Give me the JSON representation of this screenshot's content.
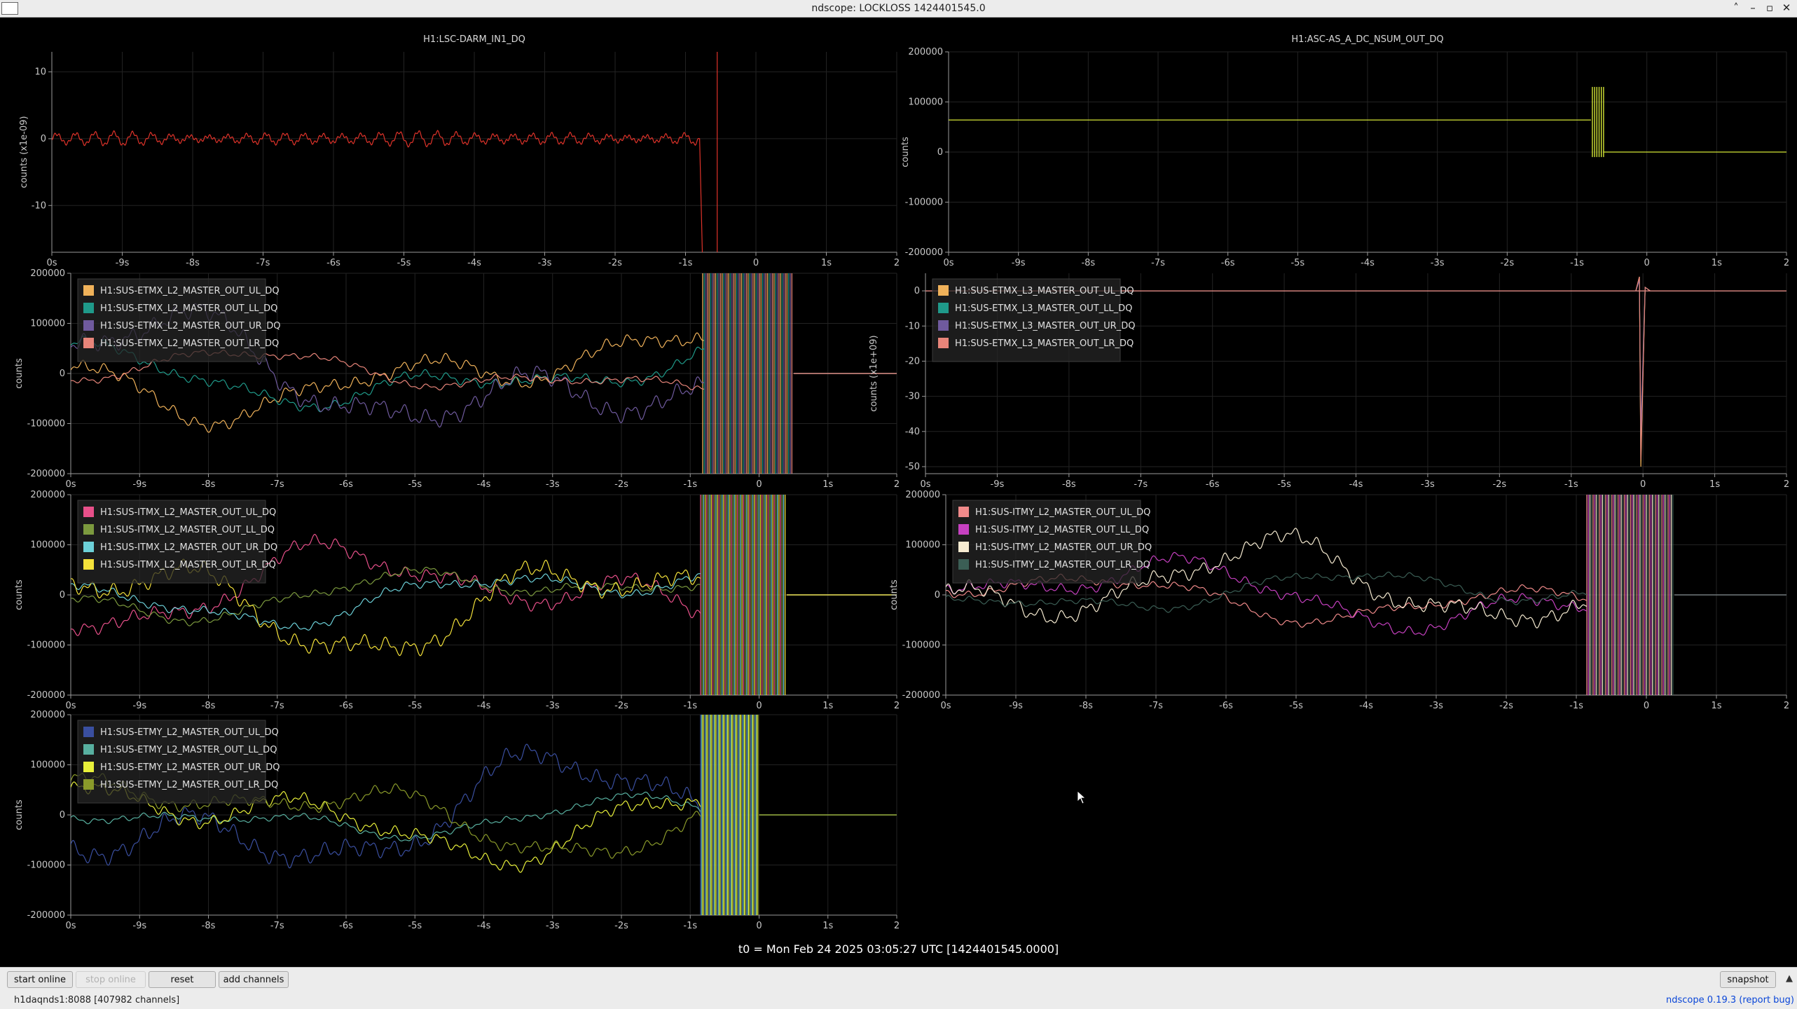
{
  "window": {
    "title": "ndscope: LOCKLOSS 1424401545.0"
  },
  "x_tick_labels": [
    "0s",
    "-9s",
    "-8s",
    "-7s",
    "-6s",
    "-5s",
    "-4s",
    "-3s",
    "-2s",
    "-1s",
    "0",
    "1s",
    "2"
  ],
  "t0_label": "t0 = Mon Feb 24 2025 03:05:27 UTC [1424401545.0000]",
  "buttons": {
    "start_online": "start online",
    "stop_online": "stop online",
    "reset": "reset",
    "add_channels": "add channels",
    "snapshot": "snapshot"
  },
  "status": {
    "server": "h1daqnds1:8088  [407982 channels]",
    "version_link": "ndscope 0.19.3",
    "report_bug": "(report bug)"
  },
  "colors": {
    "background": "#000000",
    "axis": "#9a9a9a",
    "grid": "#262626"
  },
  "chart_data": [
    {
      "type": "line",
      "title": "H1:LSC-DARM_IN1_DQ",
      "ylabel": "counts (x1e-09)",
      "xlim": [
        -10,
        2
      ],
      "ylim": [
        -17,
        13
      ],
      "yticks": [
        10,
        0,
        -10
      ],
      "ytick_labels": [
        "10",
        "0",
        "-10"
      ],
      "legend": [],
      "series": [
        {
          "name": "",
          "color": "#e0332a",
          "kind": "osc",
          "amp": 0.7,
          "offset": 0,
          "freq": 3.7,
          "end": -0.8,
          "spike": -0.55
        }
      ]
    },
    {
      "type": "line",
      "title": "H1:ASC-AS_A_DC_NSUM_OUT_DQ",
      "ylabel": "counts",
      "xlim": [
        -10,
        2
      ],
      "ylim": [
        -200000,
        200000
      ],
      "yticks": [
        200000,
        100000,
        0,
        -100000,
        -200000
      ],
      "ytick_labels": [
        "200000",
        "100000",
        "0",
        "-100000",
        "-200000"
      ],
      "legend": [],
      "series": [
        {
          "name": "",
          "color": "#d4e636",
          "kind": "step",
          "hi": 64000,
          "lo": 0,
          "t_end": -0.8,
          "burst": [
            -0.78,
            -0.62
          ]
        }
      ]
    },
    {
      "type": "line",
      "ylabel": "counts",
      "xlim": [
        -10,
        2
      ],
      "ylim": [
        -200000,
        200000
      ],
      "yticks": [
        200000,
        100000,
        0,
        -100000,
        -200000
      ],
      "ytick_labels": [
        "200000",
        "100000",
        "0",
        "-100000",
        "-200000"
      ],
      "legend": [
        "H1:SUS-ETMX_L2_MASTER_OUT_UL_DQ",
        "H1:SUS-ETMX_L2_MASTER_OUT_LL_DQ",
        "H1:SUS-ETMX_L2_MASTER_OUT_UR_DQ",
        "H1:SUS-ETMX_L2_MASTER_OUT_LR_DQ"
      ],
      "series": [
        {
          "name": "H1:SUS-ETMX_L2_MASTER_OUT_UL_DQ",
          "color": "#f0b25a",
          "kind": "wander",
          "seed": 1,
          "amp": 120000,
          "end": -0.8,
          "flat": 0.5,
          "burst": [
            -0.82,
            0.5
          ]
        },
        {
          "name": "H1:SUS-ETMX_L2_MASTER_OUT_LL_DQ",
          "color": "#1f9a8a",
          "kind": "wander",
          "seed": 2,
          "amp": 90000,
          "end": -0.8,
          "flat": 0.5,
          "burst": [
            -0.82,
            0.5
          ]
        },
        {
          "name": "H1:SUS-ETMX_L2_MASTER_OUT_UR_DQ",
          "color": "#6f5a9e",
          "kind": "wander",
          "seed": 3,
          "amp": 170000,
          "end": -0.8,
          "flat": 0.5,
          "burst": [
            -0.82,
            0.5
          ]
        },
        {
          "name": "H1:SUS-ETMX_L2_MASTER_OUT_LR_DQ",
          "color": "#e8857a",
          "kind": "wander",
          "seed": 4,
          "amp": 60000,
          "end": -0.8,
          "flat": 0.5,
          "burst": [
            -0.82,
            0.5
          ]
        }
      ]
    },
    {
      "type": "line",
      "ylabel": "counts (x1e+09)",
      "xlim": [
        -10,
        2
      ],
      "ylim": [
        -52,
        5
      ],
      "yticks": [
        0,
        -10,
        -20,
        -30,
        -40,
        -50
      ],
      "ytick_labels": [
        "0",
        "-10",
        "-20",
        "-30",
        "-40",
        "-50"
      ],
      "legend": [
        "H1:SUS-ETMX_L3_MASTER_OUT_UL_DQ",
        "H1:SUS-ETMX_L3_MASTER_OUT_LL_DQ",
        "H1:SUS-ETMX_L3_MASTER_OUT_UR_DQ",
        "H1:SUS-ETMX_L3_MASTER_OUT_LR_DQ"
      ],
      "series": [
        {
          "name": "H1:SUS-ETMX_L3_MASTER_OUT_UL_DQ",
          "color": "#f0b25a",
          "kind": "flatspike",
          "spike": -0.05,
          "low": -50,
          "high": 4
        },
        {
          "name": "H1:SUS-ETMX_L3_MASTER_OUT_LL_DQ",
          "color": "#1f9a8a",
          "kind": "flatspike",
          "spike": -0.05,
          "low": -45,
          "high": 3
        },
        {
          "name": "H1:SUS-ETMX_L3_MASTER_OUT_UR_DQ",
          "color": "#6f5a9e",
          "kind": "flatspike",
          "spike": -0.05,
          "low": -40,
          "high": 3
        },
        {
          "name": "H1:SUS-ETMX_L3_MASTER_OUT_LR_DQ",
          "color": "#e8857a",
          "kind": "flatspike",
          "spike": -0.05,
          "low": -48,
          "high": 4
        }
      ]
    },
    {
      "type": "line",
      "ylabel": "counts",
      "xlim": [
        -10,
        2
      ],
      "ylim": [
        -200000,
        200000
      ],
      "yticks": [
        200000,
        100000,
        0,
        -100000,
        -200000
      ],
      "ytick_labels": [
        "200000",
        "100000",
        "0",
        "-100000",
        "-200000"
      ],
      "legend": [
        "H1:SUS-ITMX_L2_MASTER_OUT_UL_DQ",
        "H1:SUS-ITMX_L2_MASTER_OUT_LL_DQ",
        "H1:SUS-ITMX_L2_MASTER_OUT_UR_DQ",
        "H1:SUS-ITMX_L2_MASTER_OUT_LR_DQ"
      ],
      "series": [
        {
          "name": "H1:SUS-ITMX_L2_MASTER_OUT_UL_DQ",
          "color": "#e8508a",
          "kind": "wander",
          "seed": 5,
          "amp": 130000,
          "end": -0.85,
          "flat": 0.4,
          "burst": [
            -0.85,
            0.4
          ]
        },
        {
          "name": "H1:SUS-ITMX_L2_MASTER_OUT_LL_DQ",
          "color": "#7c9a3e",
          "kind": "wander",
          "seed": 6,
          "amp": 70000,
          "end": -0.85,
          "flat": 0.4,
          "burst": [
            -0.85,
            0.4
          ]
        },
        {
          "name": "H1:SUS-ITMX_L2_MASTER_OUT_UR_DQ",
          "color": "#6cd0d8",
          "kind": "wander",
          "seed": 7,
          "amp": 80000,
          "end": -0.85,
          "flat": 0.4,
          "burst": [
            -0.85,
            0.4
          ]
        },
        {
          "name": "H1:SUS-ITMX_L2_MASTER_OUT_LR_DQ",
          "color": "#f4e23a",
          "kind": "wander",
          "seed": 8,
          "amp": 160000,
          "end": -0.85,
          "flat": 0.4,
          "burst": [
            -0.85,
            0.4
          ]
        }
      ]
    },
    {
      "type": "line",
      "ylabel": "counts",
      "xlim": [
        -10,
        2
      ],
      "ylim": [
        -200000,
        200000
      ],
      "yticks": [
        200000,
        100000,
        0,
        -100000,
        -200000
      ],
      "ytick_labels": [
        "200000",
        "100000",
        "0",
        "-100000",
        "-200000"
      ],
      "legend": [
        "H1:SUS-ITMY_L2_MASTER_OUT_UL_DQ",
        "H1:SUS-ITMY_L2_MASTER_OUT_LL_DQ",
        "H1:SUS-ITMY_L2_MASTER_OUT_UR_DQ",
        "H1:SUS-ITMY_L2_MASTER_OUT_LR_DQ"
      ],
      "series": [
        {
          "name": "H1:SUS-ITMY_L2_MASTER_OUT_UL_DQ",
          "color": "#f08a8a",
          "kind": "wander",
          "seed": 9,
          "amp": 70000,
          "end": -0.85,
          "flat": 0.4,
          "burst": [
            -0.85,
            0.4
          ]
        },
        {
          "name": "H1:SUS-ITMY_L2_MASTER_OUT_LL_DQ",
          "color": "#c640c0",
          "kind": "wander",
          "seed": 10,
          "amp": 100000,
          "end": -0.85,
          "flat": 0.4,
          "burst": [
            -0.85,
            0.4
          ]
        },
        {
          "name": "H1:SUS-ITMY_L2_MASTER_OUT_UR_DQ",
          "color": "#f7ecd2",
          "kind": "wander",
          "seed": 11,
          "amp": 140000,
          "end": -0.85,
          "flat": 0.4,
          "burst": [
            -0.85,
            0.4
          ]
        },
        {
          "name": "H1:SUS-ITMY_L2_MASTER_OUT_LR_DQ",
          "color": "#3b5e55",
          "kind": "wander",
          "seed": 12,
          "amp": 60000,
          "end": -0.85,
          "flat": 0.4,
          "burst": [
            -0.85,
            0.4
          ]
        }
      ]
    },
    {
      "type": "line",
      "ylabel": "counts",
      "xlim": [
        -10,
        2
      ],
      "ylim": [
        -200000,
        200000
      ],
      "yticks": [
        200000,
        100000,
        0,
        -100000,
        -200000
      ],
      "ytick_labels": [
        "200000",
        "100000",
        "0",
        "-100000",
        "-200000"
      ],
      "legend": [
        "H1:SUS-ETMY_L2_MASTER_OUT_UL_DQ",
        "H1:SUS-ETMY_L2_MASTER_OUT_LL_DQ",
        "H1:SUS-ETMY_L2_MASTER_OUT_UR_DQ",
        "H1:SUS-ETMY_L2_MASTER_OUT_LR_DQ"
      ],
      "series": [
        {
          "name": "H1:SUS-ETMY_L2_MASTER_OUT_UL_DQ",
          "color": "#3a4fa0",
          "kind": "wander",
          "seed": 13,
          "amp": 170000,
          "end": -0.85,
          "flat": 0,
          "burst": [
            -0.85,
            0
          ]
        },
        {
          "name": "H1:SUS-ETMY_L2_MASTER_OUT_LL_DQ",
          "color": "#58b0a0",
          "kind": "wander",
          "seed": 14,
          "amp": 60000,
          "end": -0.85,
          "flat": 0,
          "burst": [
            -0.85,
            0
          ]
        },
        {
          "name": "H1:SUS-ETMY_L2_MASTER_OUT_UR_DQ",
          "color": "#e8f03a",
          "kind": "wander",
          "seed": 15,
          "amp": 120000,
          "end": -0.85,
          "flat": 0,
          "burst": [
            -0.85,
            0
          ]
        },
        {
          "name": "H1:SUS-ETMY_L2_MASTER_OUT_LR_DQ",
          "color": "#8a9a2a",
          "kind": "wander",
          "seed": 16,
          "amp": 110000,
          "end": -0.85,
          "flat": 0,
          "burst": [
            -0.85,
            0
          ]
        }
      ]
    }
  ]
}
